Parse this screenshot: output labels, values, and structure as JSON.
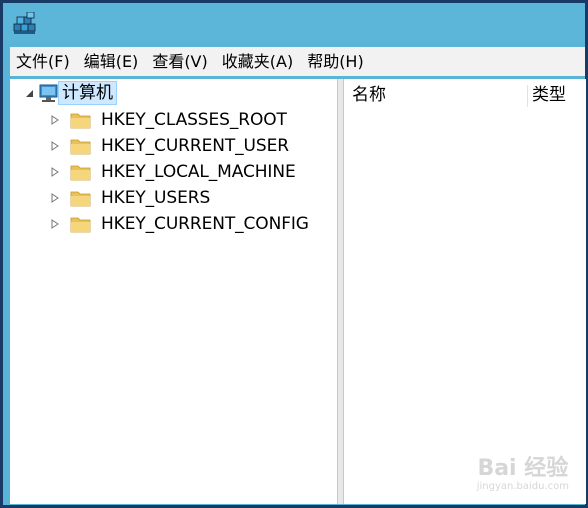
{
  "menu": {
    "items": [
      {
        "label": "文件(F)"
      },
      {
        "label": "编辑(E)"
      },
      {
        "label": "查看(V)"
      },
      {
        "label": "收藏夹(A)"
      },
      {
        "label": "帮助(H)"
      }
    ]
  },
  "tree": {
    "root": {
      "label": "计算机",
      "icon": "computer-icon",
      "expanded": true,
      "selected": true
    },
    "hives": [
      {
        "label": "HKEY_CLASSES_ROOT",
        "icon": "folder-icon"
      },
      {
        "label": "HKEY_CURRENT_USER",
        "icon": "folder-icon"
      },
      {
        "label": "HKEY_LOCAL_MACHINE",
        "icon": "folder-icon"
      },
      {
        "label": "HKEY_USERS",
        "icon": "folder-icon"
      },
      {
        "label": "HKEY_CURRENT_CONFIG",
        "icon": "folder-icon"
      }
    ]
  },
  "list": {
    "columns": [
      {
        "label": "名称"
      },
      {
        "label": "类型"
      }
    ]
  },
  "watermark": {
    "brand": "Bai 经验",
    "url": "jingyan.baidu.com"
  },
  "colors": {
    "title_bar": "#5cb6da",
    "window_border": "#1a3a66",
    "selection": "#cde8ff",
    "folder": "#e8c15a"
  }
}
